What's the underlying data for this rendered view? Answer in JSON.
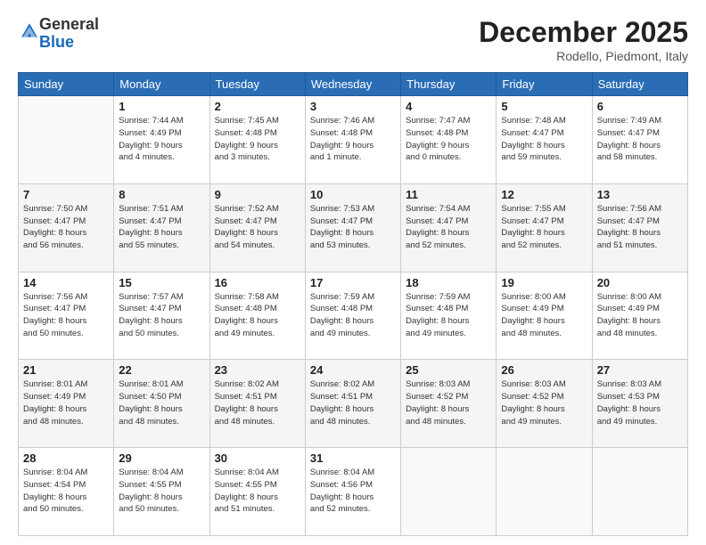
{
  "header": {
    "logo_general": "General",
    "logo_blue": "Blue",
    "month": "December 2025",
    "location": "Rodello, Piedmont, Italy"
  },
  "days_of_week": [
    "Sunday",
    "Monday",
    "Tuesday",
    "Wednesday",
    "Thursday",
    "Friday",
    "Saturday"
  ],
  "weeks": [
    [
      {
        "day": "",
        "info": ""
      },
      {
        "day": "1",
        "info": "Sunrise: 7:44 AM\nSunset: 4:49 PM\nDaylight: 9 hours\nand 4 minutes."
      },
      {
        "day": "2",
        "info": "Sunrise: 7:45 AM\nSunset: 4:48 PM\nDaylight: 9 hours\nand 3 minutes."
      },
      {
        "day": "3",
        "info": "Sunrise: 7:46 AM\nSunset: 4:48 PM\nDaylight: 9 hours\nand 1 minute."
      },
      {
        "day": "4",
        "info": "Sunrise: 7:47 AM\nSunset: 4:48 PM\nDaylight: 9 hours\nand 0 minutes."
      },
      {
        "day": "5",
        "info": "Sunrise: 7:48 AM\nSunset: 4:47 PM\nDaylight: 8 hours\nand 59 minutes."
      },
      {
        "day": "6",
        "info": "Sunrise: 7:49 AM\nSunset: 4:47 PM\nDaylight: 8 hours\nand 58 minutes."
      }
    ],
    [
      {
        "day": "7",
        "info": "Sunrise: 7:50 AM\nSunset: 4:47 PM\nDaylight: 8 hours\nand 56 minutes."
      },
      {
        "day": "8",
        "info": "Sunrise: 7:51 AM\nSunset: 4:47 PM\nDaylight: 8 hours\nand 55 minutes."
      },
      {
        "day": "9",
        "info": "Sunrise: 7:52 AM\nSunset: 4:47 PM\nDaylight: 8 hours\nand 54 minutes."
      },
      {
        "day": "10",
        "info": "Sunrise: 7:53 AM\nSunset: 4:47 PM\nDaylight: 8 hours\nand 53 minutes."
      },
      {
        "day": "11",
        "info": "Sunrise: 7:54 AM\nSunset: 4:47 PM\nDaylight: 8 hours\nand 52 minutes."
      },
      {
        "day": "12",
        "info": "Sunrise: 7:55 AM\nSunset: 4:47 PM\nDaylight: 8 hours\nand 52 minutes."
      },
      {
        "day": "13",
        "info": "Sunrise: 7:56 AM\nSunset: 4:47 PM\nDaylight: 8 hours\nand 51 minutes."
      }
    ],
    [
      {
        "day": "14",
        "info": "Sunrise: 7:56 AM\nSunset: 4:47 PM\nDaylight: 8 hours\nand 50 minutes."
      },
      {
        "day": "15",
        "info": "Sunrise: 7:57 AM\nSunset: 4:47 PM\nDaylight: 8 hours\nand 50 minutes."
      },
      {
        "day": "16",
        "info": "Sunrise: 7:58 AM\nSunset: 4:48 PM\nDaylight: 8 hours\nand 49 minutes."
      },
      {
        "day": "17",
        "info": "Sunrise: 7:59 AM\nSunset: 4:48 PM\nDaylight: 8 hours\nand 49 minutes."
      },
      {
        "day": "18",
        "info": "Sunrise: 7:59 AM\nSunset: 4:48 PM\nDaylight: 8 hours\nand 49 minutes."
      },
      {
        "day": "19",
        "info": "Sunrise: 8:00 AM\nSunset: 4:49 PM\nDaylight: 8 hours\nand 48 minutes."
      },
      {
        "day": "20",
        "info": "Sunrise: 8:00 AM\nSunset: 4:49 PM\nDaylight: 8 hours\nand 48 minutes."
      }
    ],
    [
      {
        "day": "21",
        "info": "Sunrise: 8:01 AM\nSunset: 4:49 PM\nDaylight: 8 hours\nand 48 minutes."
      },
      {
        "day": "22",
        "info": "Sunrise: 8:01 AM\nSunset: 4:50 PM\nDaylight: 8 hours\nand 48 minutes."
      },
      {
        "day": "23",
        "info": "Sunrise: 8:02 AM\nSunset: 4:51 PM\nDaylight: 8 hours\nand 48 minutes."
      },
      {
        "day": "24",
        "info": "Sunrise: 8:02 AM\nSunset: 4:51 PM\nDaylight: 8 hours\nand 48 minutes."
      },
      {
        "day": "25",
        "info": "Sunrise: 8:03 AM\nSunset: 4:52 PM\nDaylight: 8 hours\nand 48 minutes."
      },
      {
        "day": "26",
        "info": "Sunrise: 8:03 AM\nSunset: 4:52 PM\nDaylight: 8 hours\nand 49 minutes."
      },
      {
        "day": "27",
        "info": "Sunrise: 8:03 AM\nSunset: 4:53 PM\nDaylight: 8 hours\nand 49 minutes."
      }
    ],
    [
      {
        "day": "28",
        "info": "Sunrise: 8:04 AM\nSunset: 4:54 PM\nDaylight: 8 hours\nand 50 minutes."
      },
      {
        "day": "29",
        "info": "Sunrise: 8:04 AM\nSunset: 4:55 PM\nDaylight: 8 hours\nand 50 minutes."
      },
      {
        "day": "30",
        "info": "Sunrise: 8:04 AM\nSunset: 4:55 PM\nDaylight: 8 hours\nand 51 minutes."
      },
      {
        "day": "31",
        "info": "Sunrise: 8:04 AM\nSunset: 4:56 PM\nDaylight: 8 hours\nand 52 minutes."
      },
      {
        "day": "",
        "info": ""
      },
      {
        "day": "",
        "info": ""
      },
      {
        "day": "",
        "info": ""
      }
    ]
  ]
}
